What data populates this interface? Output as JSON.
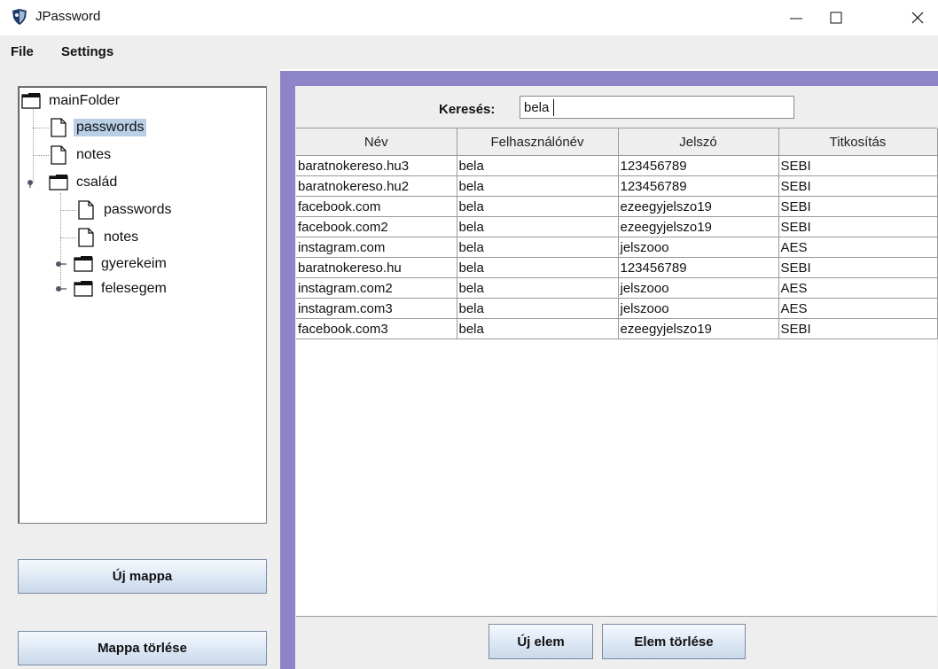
{
  "window": {
    "title": "JPassword",
    "icons": {
      "app": "shield-icon",
      "minimize": "minimize-icon",
      "maximize": "maximize-icon",
      "close": "close-icon"
    }
  },
  "menu": {
    "file": "File",
    "settings": "Settings"
  },
  "tree": {
    "root": "mainFolder",
    "items": [
      {
        "label": "passwords",
        "type": "file",
        "selected": true
      },
      {
        "label": "notes",
        "type": "file"
      },
      {
        "label": "család",
        "type": "folder",
        "expanded": true
      },
      {
        "label": "passwords",
        "type": "file"
      },
      {
        "label": "notes",
        "type": "file"
      },
      {
        "label": "gyerekeim",
        "type": "folder",
        "expanded": false
      },
      {
        "label": "felesegem",
        "type": "folder",
        "expanded": false
      }
    ]
  },
  "left_buttons": {
    "new_folder": "Új mappa",
    "delete_folder": "Mappa törlése"
  },
  "search": {
    "label": "Keresés:",
    "value": "bela"
  },
  "table": {
    "columns": [
      "Név",
      "Felhasználónév",
      "Jelszó",
      "Titkosítás"
    ],
    "rows": [
      [
        "baratnokereso.hu3",
        "bela",
        "123456789",
        "SEBI"
      ],
      [
        "baratnokereso.hu2",
        "bela",
        "123456789",
        "SEBI"
      ],
      [
        "facebook.com",
        "bela",
        "ezeegyjelszo19",
        "SEBI"
      ],
      [
        "facebook.com2",
        "bela",
        "ezeegyjelszo19",
        "SEBI"
      ],
      [
        "instagram.com",
        "bela",
        "jelszooo",
        "AES"
      ],
      [
        "baratnokereso.hu",
        "bela",
        "123456789",
        "SEBI"
      ],
      [
        "instagram.com2",
        "bela",
        "jelszooo",
        "AES"
      ],
      [
        "instagram.com3",
        "bela",
        "jelszooo",
        "AES"
      ],
      [
        "facebook.com3",
        "bela",
        "ezeegyjelszo19",
        "SEBI"
      ]
    ]
  },
  "bottom_buttons": {
    "new_item": "Új elem",
    "delete_item": "Elem törlése"
  },
  "colors": {
    "panel_border": "#8e85c9",
    "selection": "#b8cfe5",
    "background": "#eeeeee"
  }
}
